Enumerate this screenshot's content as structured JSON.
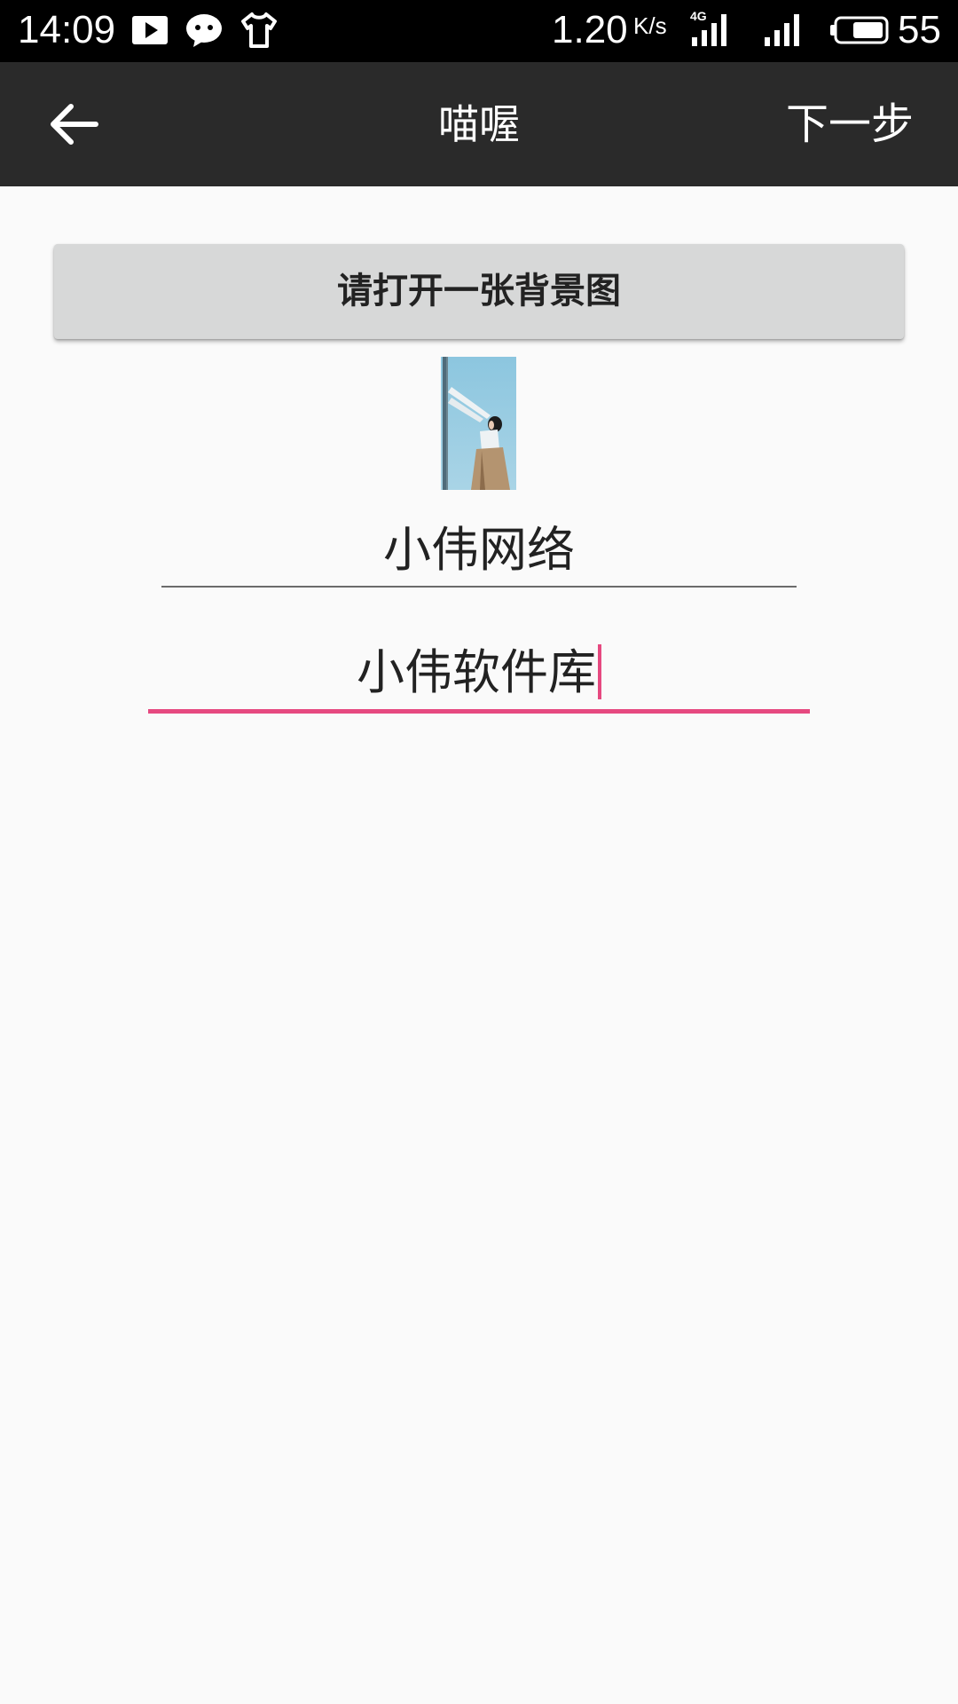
{
  "status_bar": {
    "time": "14:09",
    "speed": "1.20",
    "speed_unit": "K/s",
    "network_badge": "4G",
    "battery": "55",
    "icons": [
      "play-icon",
      "wechat-icon",
      "tshirt-icon",
      "signal-4g-icon",
      "signal-icon",
      "battery-icon"
    ]
  },
  "app_bar": {
    "title": "喵喔",
    "next_label": "下一步",
    "back_icon": "arrow-left-icon"
  },
  "main": {
    "open_background_label": "请打开一张背景图",
    "thumbnail_icon": "background-image-thumbnail",
    "field_1_value": "小伟网络",
    "field_2_value": "小伟软件库"
  },
  "colors": {
    "status_bar": "#000000",
    "app_bar": "#2a2a2a",
    "accent": "#e64980",
    "button_bg": "#d7d8d8",
    "page_bg": "#fafafa"
  }
}
